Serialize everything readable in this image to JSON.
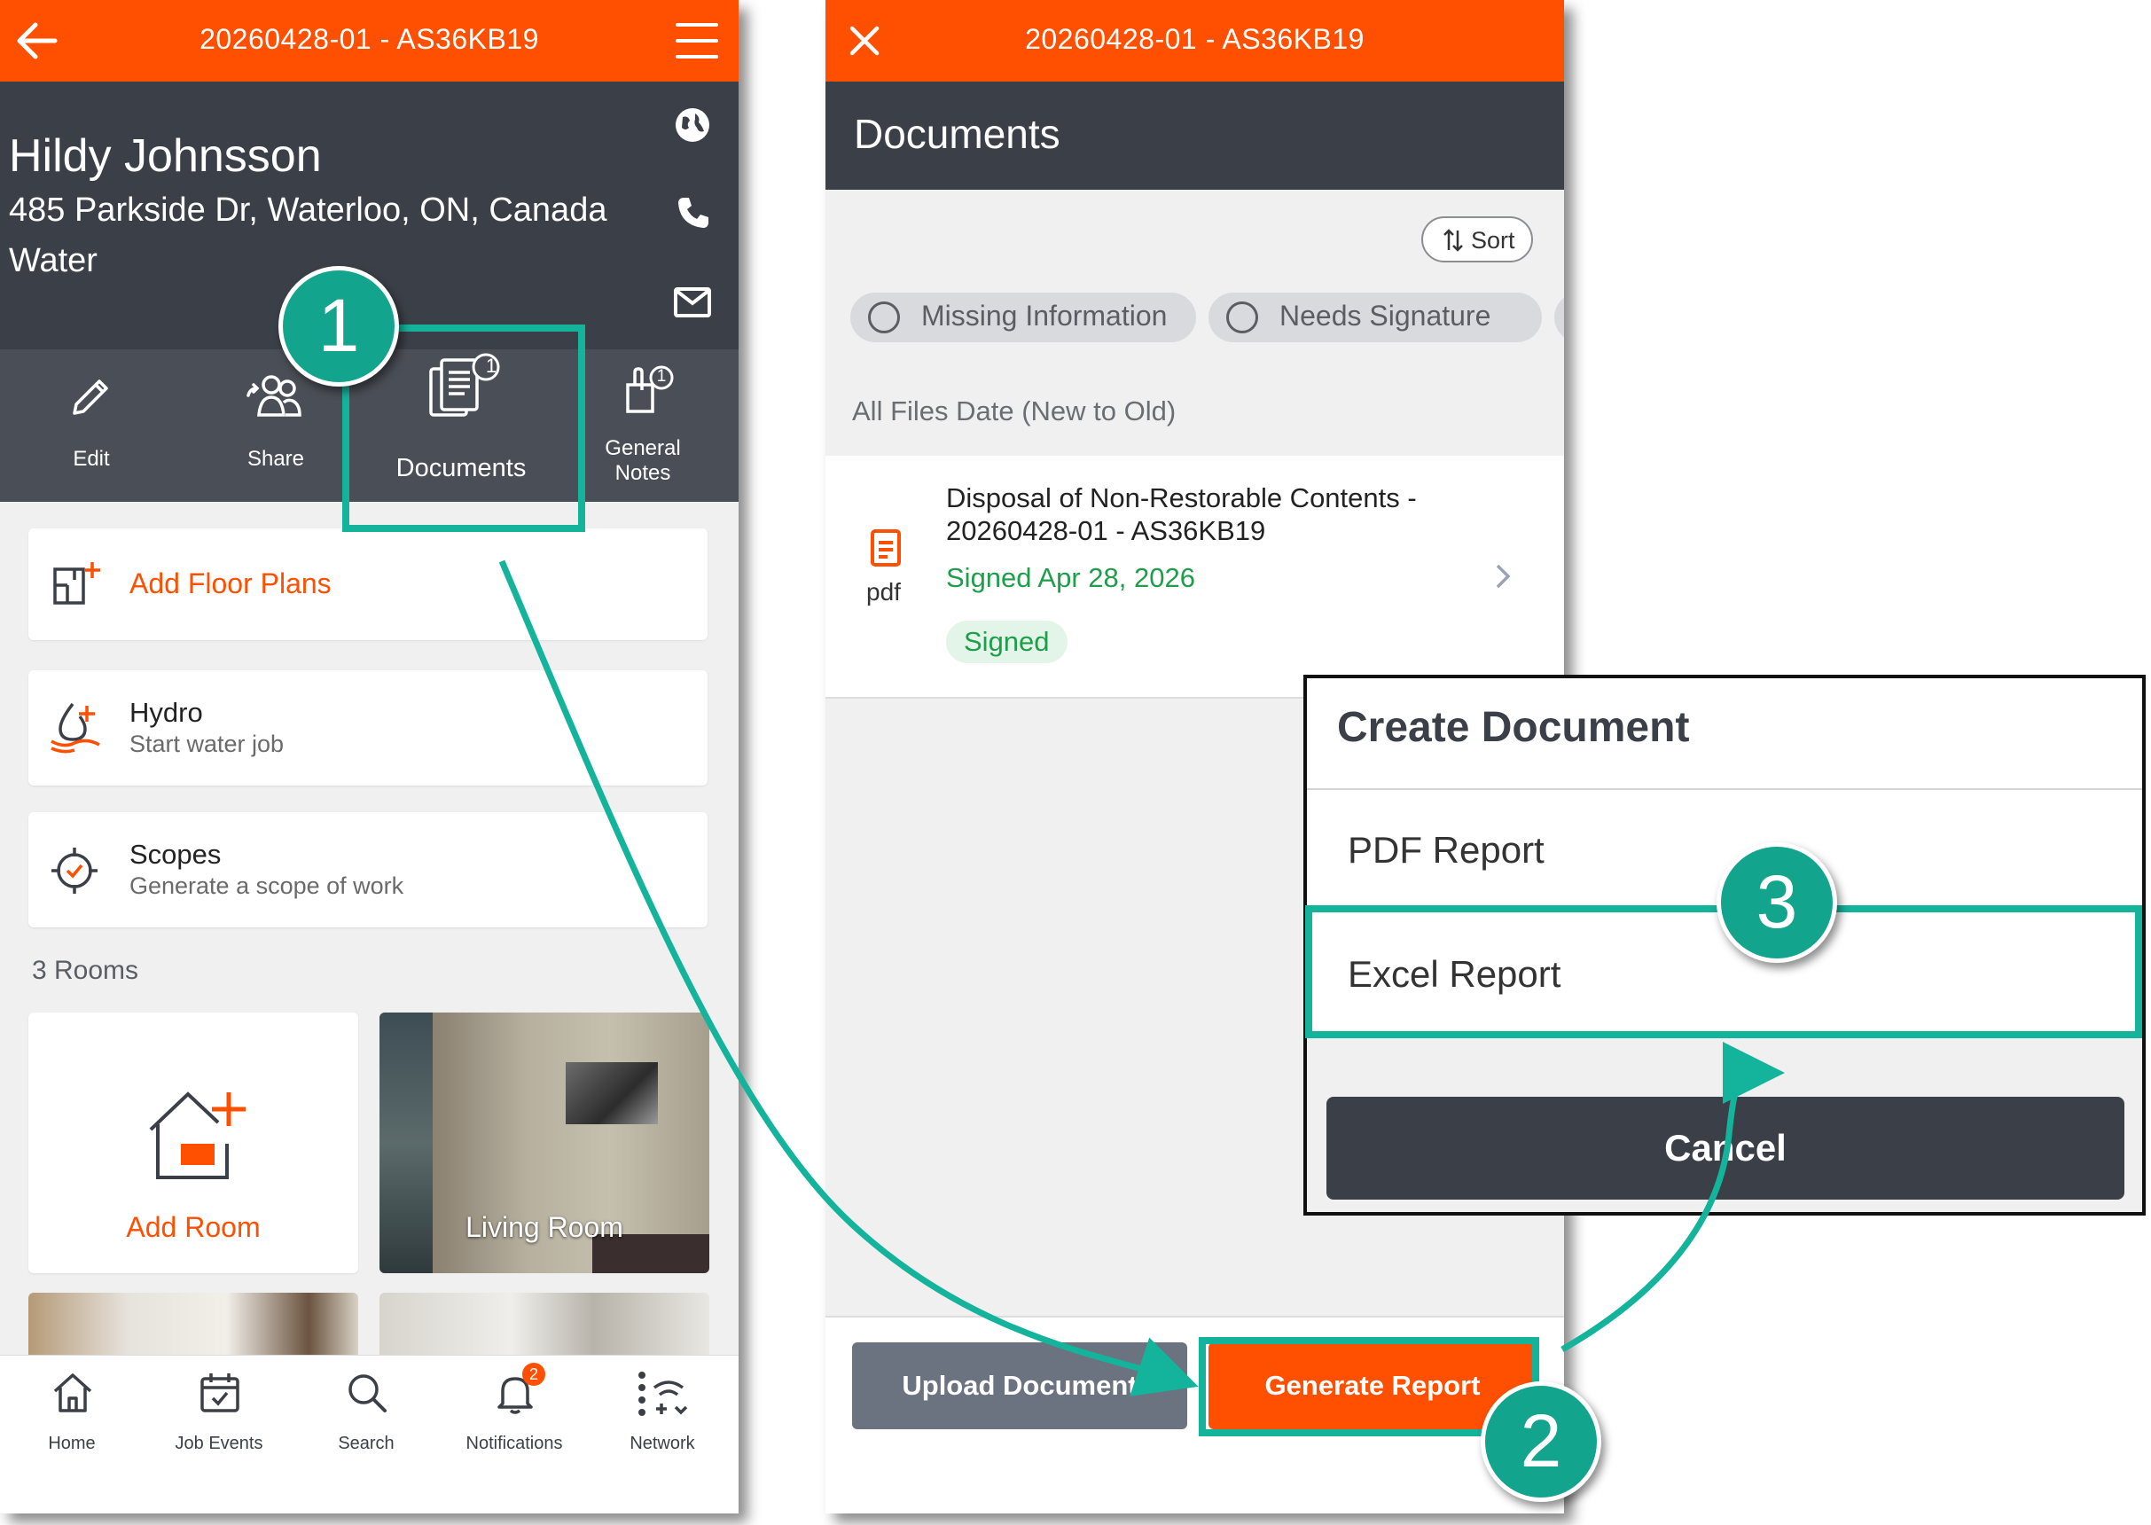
{
  "left_screen": {
    "header_title": "20260428-01 - AS36KB19",
    "customer_name": "Hildy Johnsson",
    "address": "485 Parkside Dr, Waterloo, ON, Canada",
    "job_type": "Water",
    "actions": {
      "edit": "Edit",
      "share": "Share",
      "documents": "Documents",
      "documents_count": "1",
      "general_notes_line1": "General",
      "general_notes_line2": "Notes",
      "general_notes_count": "1"
    },
    "add_floor_plans": "Add Floor Plans",
    "hydro": {
      "title": "Hydro",
      "subtitle": "Start water job"
    },
    "scopes": {
      "title": "Scopes",
      "subtitle": "Generate a scope of work"
    },
    "rooms_count_label": "3 Rooms",
    "add_room": "Add Room",
    "living_room": "Living Room",
    "bottom_nav": {
      "home": "Home",
      "job_events": "Job Events",
      "search": "Search",
      "notifications": "Notifications",
      "notifications_badge": "2",
      "network": "Network"
    }
  },
  "right_screen": {
    "header_title": "20260428-01 - AS36KB19",
    "page_title": "Documents",
    "sort_label": "Sort",
    "filters": [
      "Missing Information",
      "Needs Signature"
    ],
    "list_header": "All Files Date (New to Old)",
    "document": {
      "title_line1": "Disposal of Non-Restorable Contents -",
      "title_line2": "20260428-01 - AS36KB19",
      "signed_date": "Signed Apr 28, 2026",
      "status": "Signed",
      "file_type": "pdf"
    },
    "upload_button": "Upload Document",
    "generate_button": "Generate Report"
  },
  "dialog": {
    "title": "Create Document",
    "option_pdf": "PDF Report",
    "option_excel": "Excel Report",
    "cancel": "Cancel"
  },
  "callouts": {
    "step1": "1",
    "step2": "2",
    "step3": "3"
  },
  "colors": {
    "brand_orange": "#ff4f00",
    "header_dark": "#3b3f47",
    "highlight_teal": "#14b39b",
    "signed_green": "#1e9e4a"
  }
}
